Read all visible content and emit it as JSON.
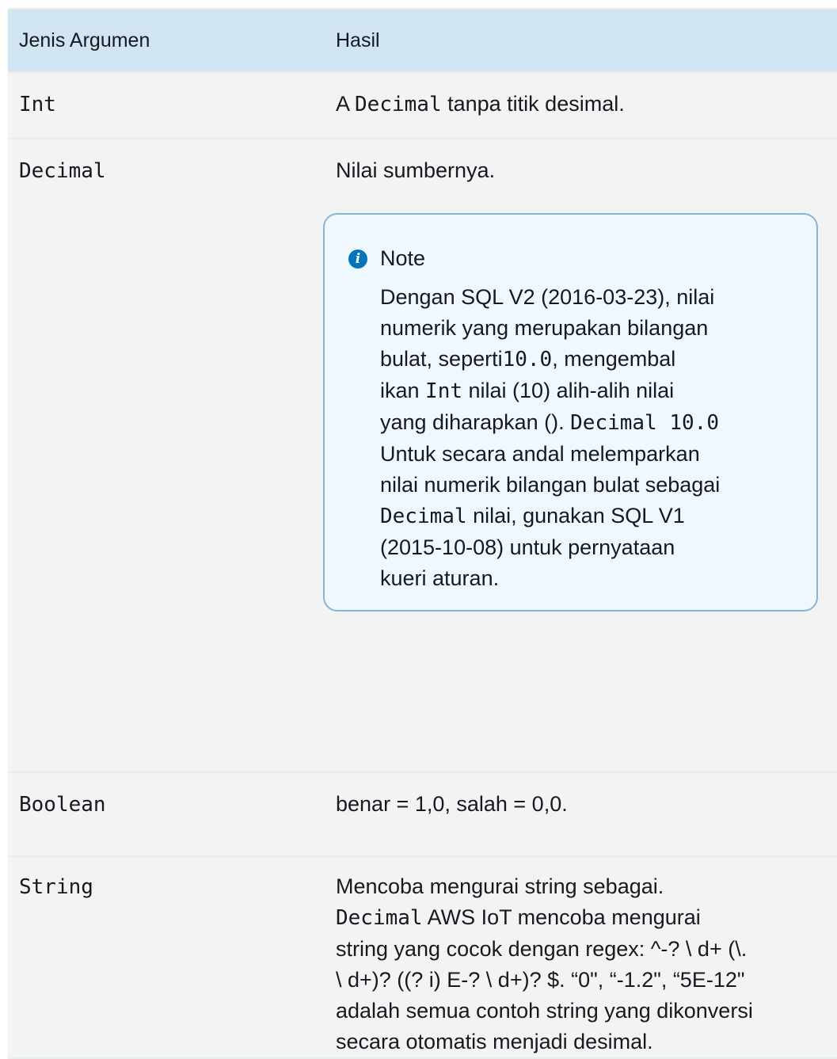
{
  "table": {
    "headers": {
      "argument_type": "Jenis Argumen",
      "result": "Hasil"
    },
    "rows": {
      "int": {
        "type": "Int",
        "result_prefix": "A ",
        "result_code": "Decimal",
        "result_suffix": " tanpa titik desimal."
      },
      "decimal": {
        "type": "Decimal",
        "result": "Nilai sumbernya.",
        "note": {
          "title": "Note",
          "line_1": "Dengan SQL V2 (2016-03-23), nilai",
          "line_2": "numerik yang merupakan bilangan",
          "line_3_text": "bulat, seperti",
          "line_3_code": "10.0",
          "line_3_tail": ", mengembal",
          "line_4_text": "ikan ",
          "line_4_code": "Int",
          "line_4_tail": " nilai (10) alih-alih nilai",
          "line_5_text": "yang diharapkan (). ",
          "line_5_code": "Decimal 10.0",
          "line_6": "Untuk secara andal melemparkan",
          "line_7": "nilai numerik bilangan bulat sebagai",
          "line_8_code": "Decimal",
          "line_8_tail": " nilai, gunakan SQL V1",
          "line_9": "(2015-10-08) untuk pernyataan",
          "line_10": "kueri aturan."
        }
      },
      "boolean": {
        "type": "Boolean",
        "result": "benar = 1,0, salah = 0,0."
      },
      "string": {
        "type": "String",
        "line_1": "Mencoba mengurai string sebagai.",
        "line_2_code": "Decimal",
        "line_2_tail": " AWS IoT mencoba mengurai",
        "line_3": "string yang cocok dengan regex: ^-? \\ d+ (\\.",
        "line_4": "\\ d+)? ((? i) E-? \\ d+)? $. “0\", “-1.2\", “5E-12\"",
        "line_5": "adalah semua contoh string yang dikonversi",
        "line_6": "secara otomatis menjadi desimal."
      }
    }
  },
  "icons": {
    "note_icon": "info-circle-icon"
  },
  "colors": {
    "header_bg": "#d1e4f2",
    "row_bg": "#f2f3f3",
    "note_border": "#88b5d7",
    "note_bg": "#f0f8ff",
    "info_icon": "#0073bb"
  }
}
